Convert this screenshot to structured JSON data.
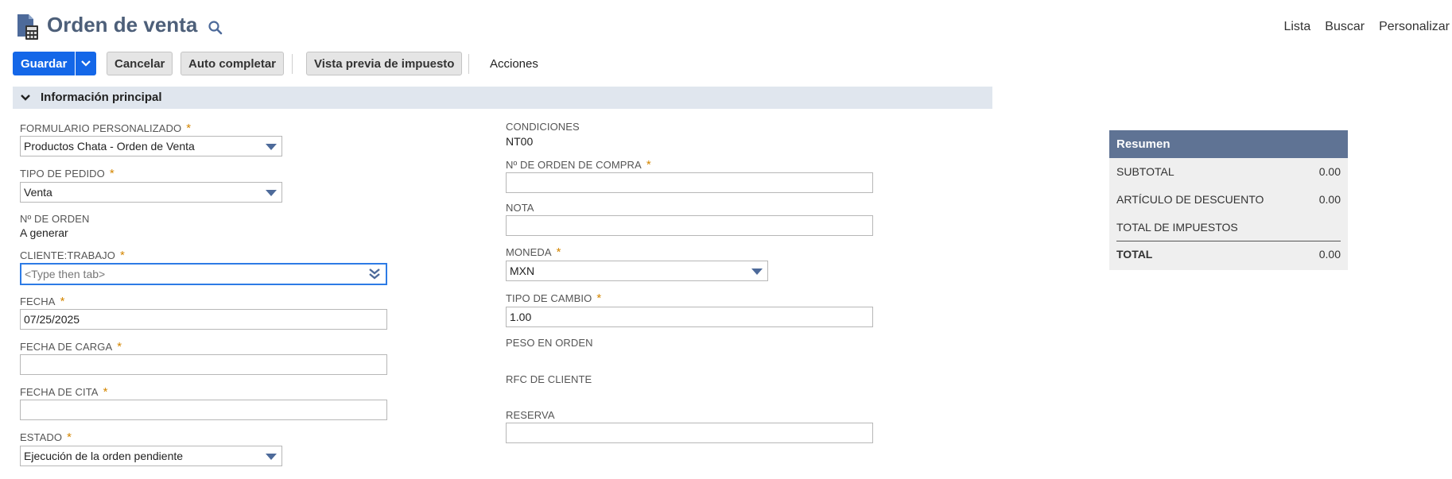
{
  "header": {
    "title": "Orden de venta",
    "links": [
      "Lista",
      "Buscar",
      "Personalizar"
    ]
  },
  "toolbar": {
    "save_label": "Guardar",
    "cancel_label": "Cancelar",
    "autocomplete_label": "Auto completar",
    "tax_preview_label": "Vista previa de impuesto",
    "actions_label": "Acciones"
  },
  "section": {
    "title": "Información principal"
  },
  "left": {
    "custom_form": {
      "label": "FORMULARIO PERSONALIZADO",
      "value": "Productos Chata - Orden de Venta"
    },
    "order_type": {
      "label": "TIPO DE PEDIDO",
      "value": "Venta"
    },
    "order_number": {
      "label": "Nº DE ORDEN",
      "value": "A generar"
    },
    "customer": {
      "label": "CLIENTE:TRABAJO",
      "placeholder": "<Type then tab>"
    },
    "date": {
      "label": "FECHA",
      "value": "07/25/2025"
    },
    "load_date": {
      "label": "FECHA DE CARGA",
      "value": ""
    },
    "appointment_date": {
      "label": "FECHA DE CITA",
      "value": ""
    },
    "status": {
      "label": "ESTADO",
      "value": "Ejecución de la orden pendiente"
    }
  },
  "right": {
    "terms": {
      "label": "CONDICIONES",
      "value": "NT00"
    },
    "po_number": {
      "label": "Nº DE ORDEN DE COMPRA",
      "value": ""
    },
    "memo": {
      "label": "NOTA",
      "value": ""
    },
    "currency": {
      "label": "MONEDA",
      "value": "MXN"
    },
    "exchange_rate": {
      "label": "TIPO DE CAMBIO",
      "value": "1.00"
    },
    "order_weight": {
      "label": "PESO EN ORDEN"
    },
    "customer_rfc": {
      "label": "RFC DE CLIENTE"
    },
    "reservation": {
      "label": "RESERVA",
      "value": ""
    }
  },
  "summary": {
    "title": "Resumen",
    "subtotal_label": "SUBTOTAL",
    "subtotal_value": "0.00",
    "discount_label": "ARTÍCULO DE DESCUENTO",
    "discount_value": "0.00",
    "tax_label": "TOTAL DE IMPUESTOS",
    "total_label": "TOTAL",
    "total_value": "0.00"
  },
  "colors": {
    "primary": "#1467e8",
    "title": "#4d5f79",
    "summary_header": "#5f7394",
    "required": "#d48600"
  }
}
